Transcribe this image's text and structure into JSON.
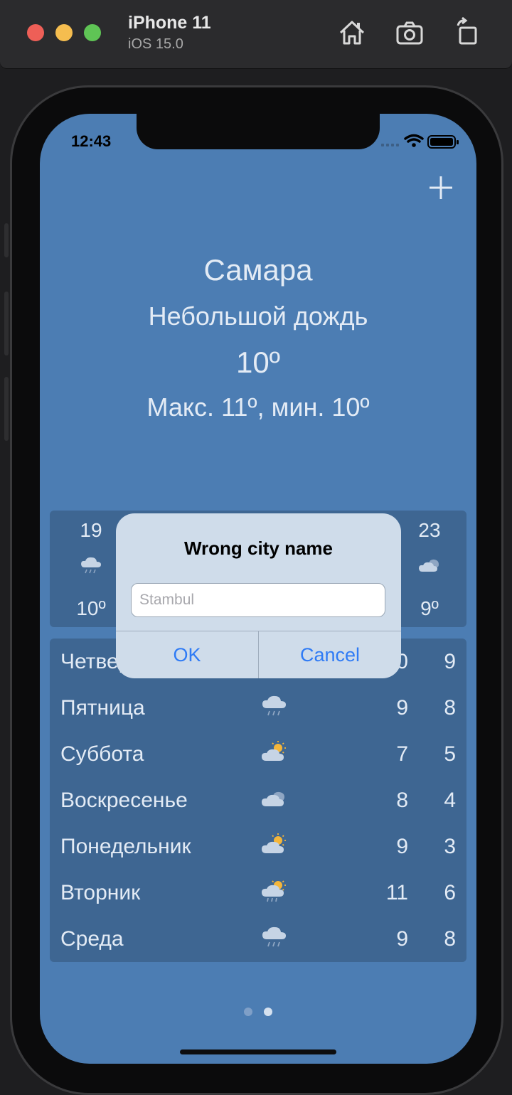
{
  "simulator": {
    "device_name": "iPhone 11",
    "os_version": "iOS 15.0",
    "icons": [
      "home-icon",
      "screenshot-icon",
      "rotate-icon"
    ]
  },
  "status_bar": {
    "time": "12:43"
  },
  "weather": {
    "city": "Самара",
    "description": "Небольшой дождь",
    "temperature": "10º",
    "max_min": "Макс. 11º, мин. 10º"
  },
  "hourly": [
    {
      "hour": "19",
      "icon": "rain-cloud-icon",
      "temp": "10º"
    },
    {
      "hour": "23",
      "icon": "cloudy-icon",
      "temp": "9º"
    }
  ],
  "daily": [
    {
      "day": "Четверг",
      "icon": "rain-cloud-icon",
      "max": "10",
      "min": "9"
    },
    {
      "day": "Пятница",
      "icon": "rain-cloud-icon",
      "max": "9",
      "min": "8"
    },
    {
      "day": "Суббота",
      "icon": "partly-sunny-icon",
      "max": "7",
      "min": "5"
    },
    {
      "day": "Воскресенье",
      "icon": "cloudy-icon",
      "max": "8",
      "min": "4"
    },
    {
      "day": "Понедельник",
      "icon": "partly-sunny-icon",
      "max": "9",
      "min": "3"
    },
    {
      "day": "Вторник",
      "icon": "sun-rain-icon",
      "max": "11",
      "min": "6"
    },
    {
      "day": "Среда",
      "icon": "rain-cloud-icon",
      "max": "9",
      "min": "8"
    }
  ],
  "alert": {
    "title": "Wrong city name",
    "placeholder": "Stambul",
    "value": "",
    "ok_label": "OK",
    "cancel_label": "Cancel"
  },
  "page_indicator": {
    "pages": 2,
    "current": 2
  },
  "colors": {
    "background": "#4c7db3",
    "panel": "#3e6692",
    "text": "#e3ebf5",
    "alert_bg": "#cfdcea",
    "alert_button": "#2f7bf5",
    "sun": "#f5b63a"
  }
}
